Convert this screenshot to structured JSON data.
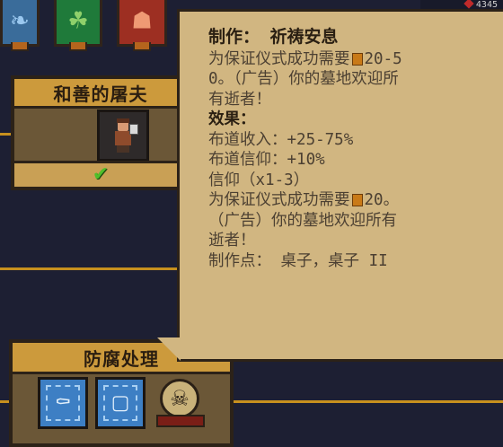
{
  "colors": {
    "background": "#1d1f33",
    "tooltip_bg": "#d1b681",
    "card_header": "#cc9a3c",
    "gold_line": "#c7901e",
    "check": "#4fbf2a"
  },
  "top_tiles": [
    {
      "name": "feather-icon",
      "glyph": "❧"
    },
    {
      "name": "leaf-icon",
      "glyph": "☘"
    },
    {
      "name": "book-icon",
      "glyph": "☗"
    }
  ],
  "top_counter": "4345",
  "cards": {
    "butcher": {
      "title": "和善的屠夫",
      "check_glyph": "✔"
    },
    "embalming": {
      "title": "防腐处理",
      "slot_glyphs": [
        "⚰",
        "▢"
      ]
    }
  },
  "tooltip": {
    "title": "制作： 祈祷安息",
    "line1": "为保证仪式成功需要",
    "line1b": "20-5",
    "line2": "0。（广告）你的墓地欢迎所",
    "line3": "有逝者！",
    "effects_label": "效果：",
    "effect1": "布道收入：+25-75%",
    "effect2": "布道信仰：+10%",
    "effect3": "信仰（x1-3）",
    "line4": "为保证仪式成功需要",
    "line4b": "20。",
    "line5": "（广告）你的墓地欢迎所有",
    "line6": "逝者！",
    "craft_points": "制作点： 桌子，桌子 II"
  }
}
